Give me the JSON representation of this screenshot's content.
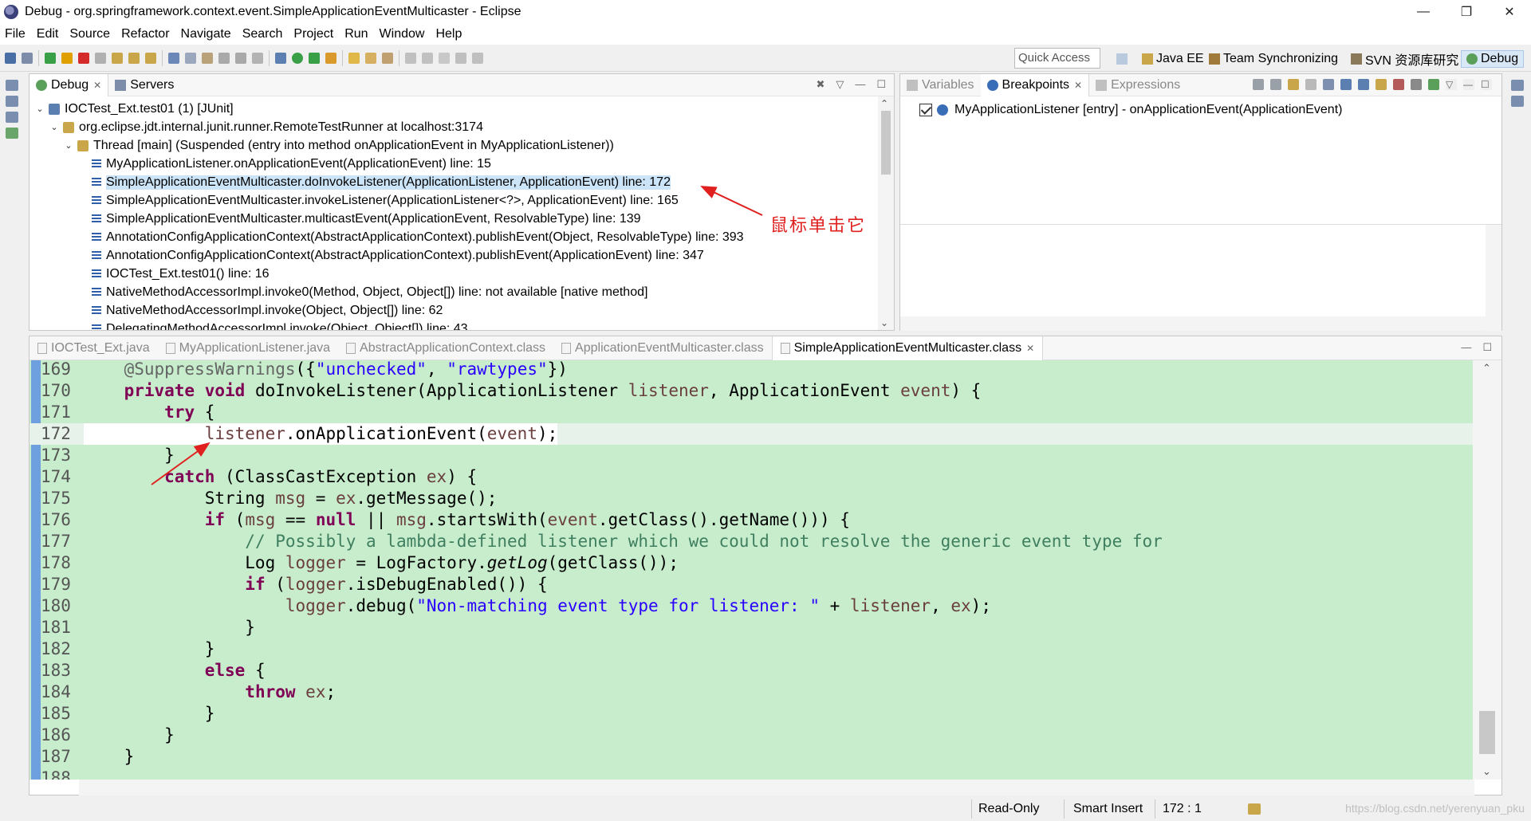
{
  "window": {
    "title": "Debug - org.springframework.context.event.SimpleApplicationEventMulticaster - Eclipse",
    "controls": [
      "—",
      "❐",
      "✕"
    ]
  },
  "menu": [
    "File",
    "Edit",
    "Source",
    "Refactor",
    "Navigate",
    "Search",
    "Project",
    "Run",
    "Window",
    "Help"
  ],
  "toolbar": {
    "quick_access": "Quick Access",
    "perspectives": [
      {
        "label": "Java EE",
        "active": false
      },
      {
        "label": "Team Synchronizing",
        "active": false
      },
      {
        "label": "SVN 资源库研究",
        "active": false
      },
      {
        "label": "Debug",
        "active": true
      }
    ]
  },
  "debug_view": {
    "tabs": [
      {
        "label": "Debug",
        "active": true
      },
      {
        "label": "Servers",
        "active": false
      }
    ],
    "tree": [
      {
        "text": "IOCTest_Ext.test01 (1) [JUnit]",
        "level": 0,
        "twisty": "v",
        "icon": "junit-icon"
      },
      {
        "text": "org.eclipse.jdt.internal.junit.runner.RemoteTestRunner at localhost:3174",
        "level": 1,
        "twisty": "v",
        "icon": "runner-icon"
      },
      {
        "text": "Thread [main] (Suspended (entry into method onApplicationEvent in MyApplicationListener))",
        "level": 2,
        "twisty": "v",
        "icon": "thread-icon"
      },
      {
        "text": "MyApplicationListener.onApplicationEvent(ApplicationEvent) line: 15",
        "level": 3,
        "twisty": "",
        "icon": "stack-frame-icon"
      },
      {
        "text": "SimpleApplicationEventMulticaster.doInvokeListener(ApplicationListener, ApplicationEvent) line: 172",
        "level": 3,
        "twisty": "",
        "icon": "stack-frame-icon",
        "selected": true
      },
      {
        "text": "SimpleApplicationEventMulticaster.invokeListener(ApplicationListener<?>, ApplicationEvent) line: 165",
        "level": 3,
        "twisty": "",
        "icon": "stack-frame-icon"
      },
      {
        "text": "SimpleApplicationEventMulticaster.multicastEvent(ApplicationEvent, ResolvableType) line: 139",
        "level": 3,
        "twisty": "",
        "icon": "stack-frame-icon"
      },
      {
        "text": "AnnotationConfigApplicationContext(AbstractApplicationContext).publishEvent(Object, ResolvableType) line: 393",
        "level": 3,
        "twisty": "",
        "icon": "stack-frame-icon"
      },
      {
        "text": "AnnotationConfigApplicationContext(AbstractApplicationContext).publishEvent(ApplicationEvent) line: 347",
        "level": 3,
        "twisty": "",
        "icon": "stack-frame-icon"
      },
      {
        "text": "IOCTest_Ext.test01() line: 16",
        "level": 3,
        "twisty": "",
        "icon": "stack-frame-icon"
      },
      {
        "text": "NativeMethodAccessorImpl.invoke0(Method, Object, Object[]) line: not available [native method]",
        "level": 3,
        "twisty": "",
        "icon": "stack-frame-icon"
      },
      {
        "text": "NativeMethodAccessorImpl.invoke(Object, Object[]) line: 62",
        "level": 3,
        "twisty": "",
        "icon": "stack-frame-icon"
      },
      {
        "text": "DelegatingMethodAccessorImpl.invoke(Object, Object[]) line: 43",
        "level": 3,
        "twisty": "",
        "icon": "stack-frame-icon"
      }
    ]
  },
  "breakpoints_view": {
    "tabs": [
      {
        "label": "Variables",
        "active": false
      },
      {
        "label": "Breakpoints",
        "active": true
      },
      {
        "label": "Expressions",
        "active": false
      }
    ],
    "items": [
      {
        "text": "MyApplicationListener [entry] - onApplicationEvent(ApplicationEvent)",
        "checked": true
      }
    ]
  },
  "editor": {
    "tabs": [
      {
        "label": "IOCTest_Ext.java",
        "active": false
      },
      {
        "label": "MyApplicationListener.java",
        "active": false
      },
      {
        "label": "AbstractApplicationContext.class",
        "active": false
      },
      {
        "label": "ApplicationEventMulticaster.class",
        "active": false
      },
      {
        "label": "SimpleApplicationEventMulticaster.class",
        "active": true
      }
    ],
    "current_line": 172,
    "lines": [
      {
        "n": "169",
        "tokens": [
          [
            "    ",
            ""
          ],
          [
            "@SuppressWarnings",
            "ann"
          ],
          [
            "({",
            ""
          ],
          [
            "\"unchecked\"",
            "str"
          ],
          [
            ", ",
            ""
          ],
          [
            "\"rawtypes\"",
            "str"
          ],
          [
            "})",
            ""
          ]
        ]
      },
      {
        "n": "170",
        "tokens": [
          [
            "    ",
            ""
          ],
          [
            "private",
            "kw"
          ],
          [
            " ",
            ""
          ],
          [
            "void",
            "kw"
          ],
          [
            " doInvokeListener(ApplicationListener ",
            ""
          ],
          [
            "listener",
            "var"
          ],
          [
            ", ApplicationEvent ",
            ""
          ],
          [
            "event",
            "var"
          ],
          [
            ") {",
            ""
          ]
        ]
      },
      {
        "n": "171",
        "tokens": [
          [
            "        ",
            ""
          ],
          [
            "try",
            "kw"
          ],
          [
            " {",
            ""
          ]
        ]
      },
      {
        "n": "172",
        "tokens": [
          [
            "            ",
            ""
          ],
          [
            "listener",
            "var"
          ],
          [
            ".onApplicationEvent(",
            ""
          ],
          [
            "event",
            "var"
          ],
          [
            ");",
            ""
          ]
        ]
      },
      {
        "n": "173",
        "tokens": [
          [
            "        }",
            ""
          ]
        ]
      },
      {
        "n": "174",
        "tokens": [
          [
            "        ",
            ""
          ],
          [
            "catch",
            "kw"
          ],
          [
            " (ClassCastException ",
            ""
          ],
          [
            "ex",
            "var"
          ],
          [
            ") {",
            ""
          ]
        ]
      },
      {
        "n": "175",
        "tokens": [
          [
            "            String ",
            ""
          ],
          [
            "msg",
            "var"
          ],
          [
            " = ",
            ""
          ],
          [
            "ex",
            "var"
          ],
          [
            ".getMessage();",
            ""
          ]
        ]
      },
      {
        "n": "176",
        "tokens": [
          [
            "            ",
            ""
          ],
          [
            "if",
            "kw"
          ],
          [
            " (",
            ""
          ],
          [
            "msg",
            "var"
          ],
          [
            " == ",
            ""
          ],
          [
            "null",
            "kw"
          ],
          [
            " || ",
            ""
          ],
          [
            "msg",
            "var"
          ],
          [
            ".startsWith(",
            ""
          ],
          [
            "event",
            "var"
          ],
          [
            ".getClass().getName())) {",
            ""
          ]
        ]
      },
      {
        "n": "177",
        "tokens": [
          [
            "                ",
            ""
          ],
          [
            "// Possibly a lambda-defined listener which we could not resolve the generic event type for",
            "cmt"
          ]
        ]
      },
      {
        "n": "178",
        "tokens": [
          [
            "                Log ",
            ""
          ],
          [
            "logger",
            "var"
          ],
          [
            " = LogFactory.",
            ""
          ],
          [
            "getLog",
            "itl"
          ],
          [
            "(getClass());",
            ""
          ]
        ]
      },
      {
        "n": "179",
        "tokens": [
          [
            "                ",
            ""
          ],
          [
            "if",
            "kw"
          ],
          [
            " (",
            ""
          ],
          [
            "logger",
            "var"
          ],
          [
            ".isDebugEnabled()) {",
            ""
          ]
        ]
      },
      {
        "n": "180",
        "tokens": [
          [
            "                    ",
            ""
          ],
          [
            "logger",
            "var"
          ],
          [
            ".debug(",
            ""
          ],
          [
            "\"Non-matching event type for listener: \"",
            "str"
          ],
          [
            " + ",
            ""
          ],
          [
            "listener",
            "var"
          ],
          [
            ", ",
            ""
          ],
          [
            "ex",
            "var"
          ],
          [
            ");",
            ""
          ]
        ]
      },
      {
        "n": "181",
        "tokens": [
          [
            "                }",
            ""
          ]
        ]
      },
      {
        "n": "182",
        "tokens": [
          [
            "            }",
            ""
          ]
        ]
      },
      {
        "n": "183",
        "tokens": [
          [
            "            ",
            ""
          ],
          [
            "else",
            "kw"
          ],
          [
            " {",
            ""
          ]
        ]
      },
      {
        "n": "184",
        "tokens": [
          [
            "                ",
            ""
          ],
          [
            "throw",
            "kw"
          ],
          [
            " ",
            ""
          ],
          [
            "ex",
            "var"
          ],
          [
            ";",
            ""
          ]
        ]
      },
      {
        "n": "185",
        "tokens": [
          [
            "            }",
            ""
          ]
        ]
      },
      {
        "n": "186",
        "tokens": [
          [
            "        }",
            ""
          ]
        ]
      },
      {
        "n": "187",
        "tokens": [
          [
            "    }",
            ""
          ]
        ]
      },
      {
        "n": "188",
        "tokens": [
          [
            "",
            ""
          ]
        ]
      }
    ]
  },
  "annotation": {
    "text": "鼠标单击它",
    "color": "#e0201e"
  },
  "status": {
    "read_only": "Read-Only",
    "insert_mode": "Smart Insert",
    "position": "172 : 1",
    "watermark": "https://blog.csdn.net/yerenyuan_pku"
  },
  "colors": {
    "editor_bg": "#c7edcc",
    "keyword": "#7f0055",
    "string": "#2a00ff",
    "comment": "#3f7f5f",
    "selection": "#cce4f7"
  }
}
